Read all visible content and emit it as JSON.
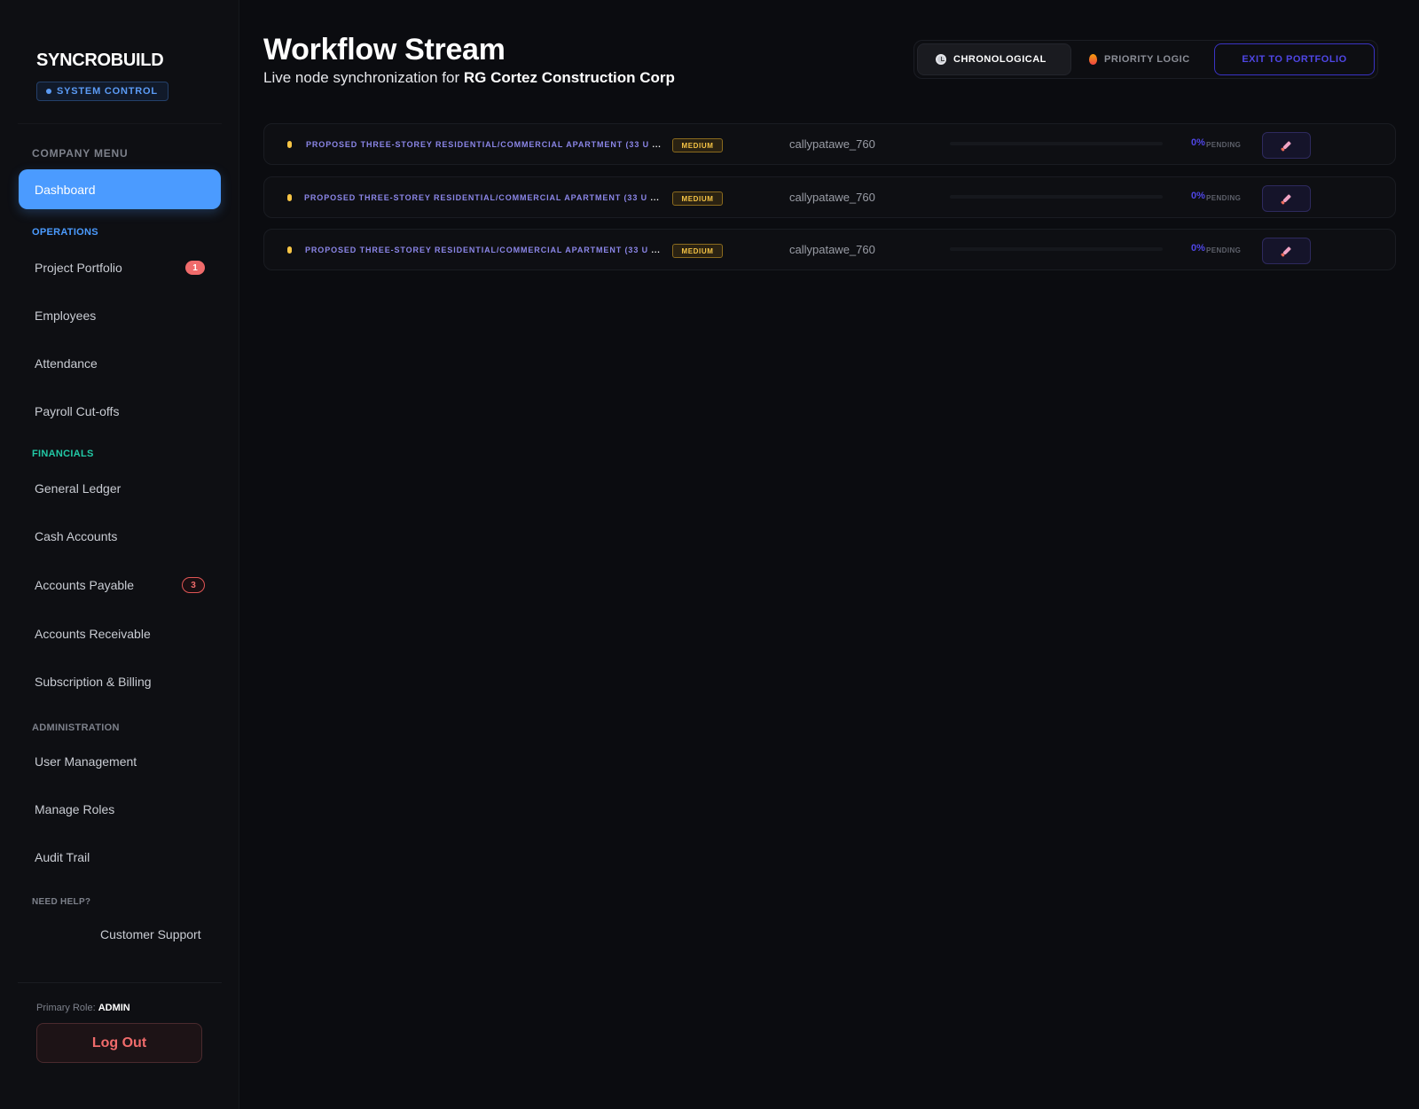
{
  "sidebar": {
    "brand": "SYNCROBUILD",
    "system_badge": "SYSTEM CONTROL",
    "menu_heading": "COMPANY MENU",
    "active_item": "Dashboard",
    "sections": {
      "operations": "OPERATIONS",
      "financials": "FINANCIALS",
      "administration": "ADMINISTRATION",
      "help": "NEED HELP?"
    },
    "items": {
      "project_portfolio": {
        "label": "Project Portfolio",
        "badge": "1"
      },
      "employees": {
        "label": "Employees"
      },
      "attendance": {
        "label": "Attendance"
      },
      "payroll": {
        "label": "Payroll Cut-offs"
      },
      "general_ledger": {
        "label": "General Ledger"
      },
      "cash_accounts": {
        "label": "Cash Accounts"
      },
      "accounts_payable": {
        "label": "Accounts Payable",
        "badge": "3"
      },
      "accounts_receivable": {
        "label": "Accounts Receivable"
      },
      "subscription": {
        "label": "Subscription & Billing"
      },
      "user_management": {
        "label": "User Management"
      },
      "manage_roles": {
        "label": "Manage Roles"
      },
      "audit_trail": {
        "label": "Audit Trail"
      },
      "customer_support": {
        "label": "Customer Support"
      }
    },
    "footer": {
      "role_prefix": "Primary Role:",
      "role_value": "ADMIN",
      "logout_label": "Log Out"
    }
  },
  "header": {
    "title": "Workflow Stream",
    "subtitle_prefix": "Live node synchronization for",
    "company": "RG Cortez Construction Corp"
  },
  "toolbar": {
    "chronological": {
      "label": "CHRONOLOGICAL",
      "icon": "clock-icon"
    },
    "priority": {
      "label": "PRIORITY LOGIC",
      "icon": "flame-icon"
    },
    "exit": {
      "label": "EXIT TO PORTFOLIO"
    }
  },
  "rows": [
    {
      "title": "PROPOSED THREE-STOREY RESIDENTIAL/COMMERCIAL APARTMENT (33 U",
      "ellipsis": "...",
      "priority": "MEDIUM",
      "user": "callypatawe_760",
      "progress_percent": 0,
      "progress_label": "0%",
      "status": "PENDING",
      "action_icon": "rocket-icon"
    },
    {
      "title": "PROPOSED THREE-STOREY RESIDENTIAL/COMMERCIAL APARTMENT (33 U",
      "ellipsis": "...",
      "priority": "MEDIUM",
      "user": "callypatawe_760",
      "progress_percent": 0,
      "progress_label": "0%",
      "status": "PENDING",
      "action_icon": "rocket-icon"
    },
    {
      "title": "PROPOSED THREE-STOREY RESIDENTIAL/COMMERCIAL APARTMENT (33 U",
      "ellipsis": "...",
      "priority": "MEDIUM",
      "user": "callypatawe_760",
      "progress_percent": 0,
      "progress_label": "0%",
      "status": "PENDING",
      "action_icon": "rocket-icon"
    }
  ],
  "colors": {
    "background": "#0b0c10",
    "accent_blue": "#4b9bff",
    "accent_indigo": "#4f46e5",
    "financials_teal": "#22c9a6",
    "priority_medium": "#f6c445",
    "danger": "#f06b6b"
  }
}
